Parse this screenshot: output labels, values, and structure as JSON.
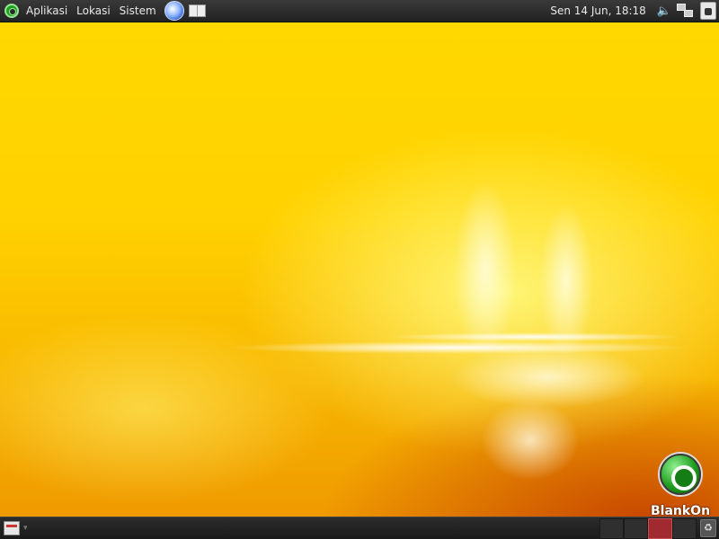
{
  "top_panel": {
    "menus": [
      "Aplikasi",
      "Lokasi",
      "Sistem"
    ],
    "clock": "Sen 14 Jun, 18:18",
    "icons": {
      "app_menu": "blankon-logo-icon",
      "browser": "web-browser-icon",
      "files": "file-manager-icon",
      "volume": "volume-icon",
      "network": "network-icon",
      "power": "power-icon"
    }
  },
  "desktop": {
    "brand": "BlankOn"
  },
  "bottom_panel": {
    "workspaces": 4,
    "active_workspace": 3,
    "icons": {
      "show_desktop": "show-desktop-icon",
      "trash": "trash-icon"
    }
  },
  "colors": {
    "panel": "#222222",
    "active_workspace": "#a02a30",
    "wallpaper": "#ffd100"
  }
}
